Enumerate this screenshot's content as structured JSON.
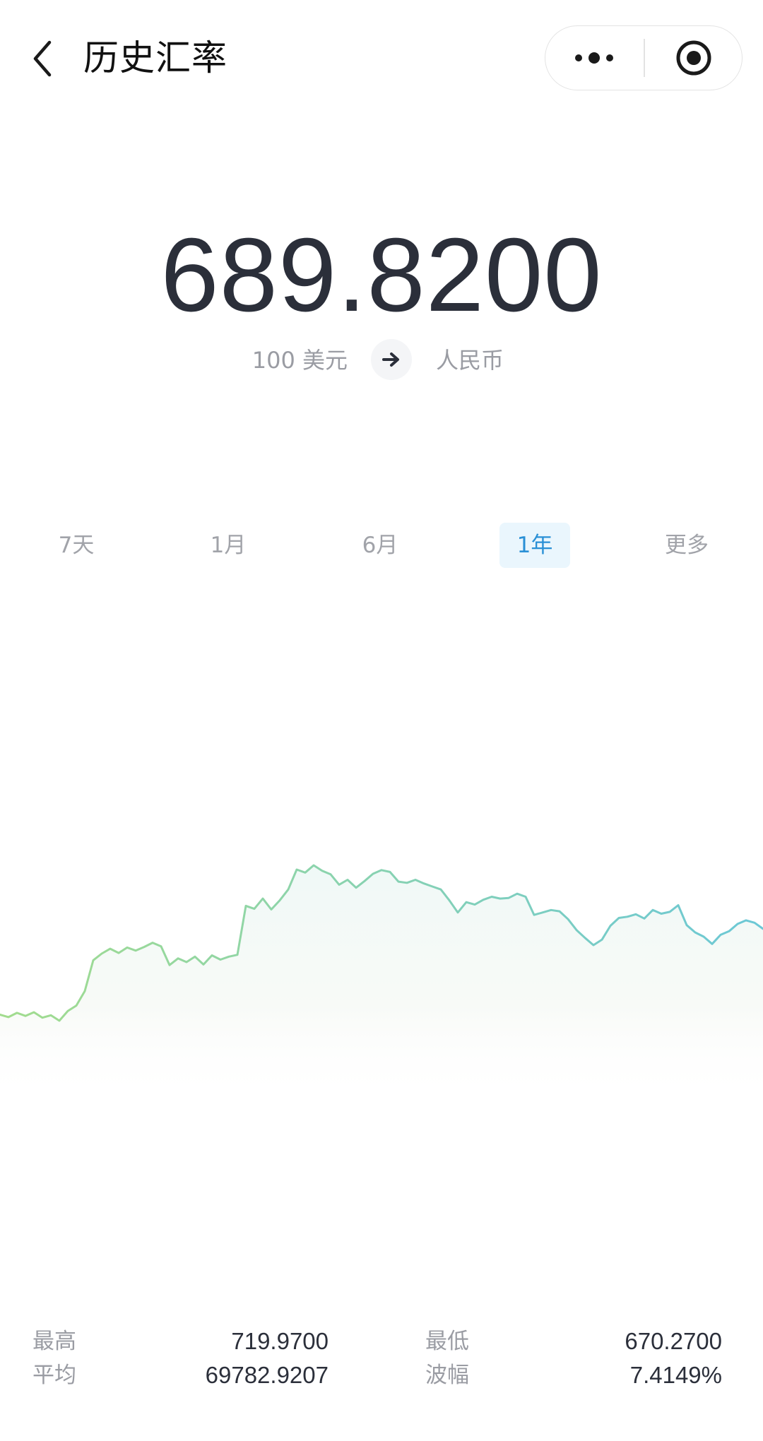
{
  "header": {
    "title": "历史汇率",
    "back_icon": "chevron-left-icon",
    "more_icon": "more-dots-icon",
    "close_icon": "target-circle-icon"
  },
  "rate": {
    "value": "689.8200",
    "from": "100 美元",
    "to": "人民币",
    "swap_icon": "arrow-right-icon"
  },
  "tabs": [
    {
      "label": "7天",
      "active": false
    },
    {
      "label": "1月",
      "active": false
    },
    {
      "label": "6月",
      "active": false
    },
    {
      "label": "1年",
      "active": true
    },
    {
      "label": "更多",
      "active": false
    }
  ],
  "colors": {
    "line_start": "#a2dc8e",
    "line_end": "#6cc8d6",
    "active_tab_bg": "#eaf6fd",
    "active_tab_text": "#2a90d6"
  },
  "chart_data": {
    "type": "area",
    "y": [
      675.6,
      675.2,
      675.9,
      675.4,
      676.0,
      675.1,
      675.5,
      674.6,
      676.2,
      677.1,
      679.5,
      684.6,
      685.7,
      686.5,
      685.8,
      686.7,
      686.2,
      686.8,
      687.5,
      686.9,
      683.8,
      684.9,
      684.3,
      685.2,
      683.9,
      685.4,
      684.7,
      685.2,
      685.5,
      693.6,
      693.1,
      694.8,
      693.0,
      694.5,
      696.3,
      699.6,
      699.1,
      700.3,
      699.4,
      698.8,
      697.1,
      697.9,
      696.6,
      697.7,
      698.9,
      699.5,
      699.2,
      697.6,
      697.4,
      697.9,
      697.3,
      696.8,
      696.3,
      694.5,
      692.5,
      694.2,
      693.8,
      694.6,
      695.1,
      694.8,
      694.9,
      695.6,
      695.1,
      692.1,
      692.5,
      692.9,
      692.7,
      691.4,
      689.6,
      688.3,
      687.1,
      688.0,
      690.3,
      691.6,
      691.8,
      692.2,
      691.5,
      692.9,
      692.3,
      692.6,
      693.7,
      690.4,
      689.2,
      688.5,
      687.3,
      688.8,
      689.4,
      690.6,
      691.2,
      690.8,
      689.8
    ]
  },
  "stats": {
    "high_label": "最高",
    "high_value": "719.9700",
    "low_label": "最低",
    "low_value": "670.2700",
    "avg_label": "平均",
    "avg_value": "69782.9207",
    "amp_label": "波幅",
    "amp_value": "7.4149%"
  }
}
